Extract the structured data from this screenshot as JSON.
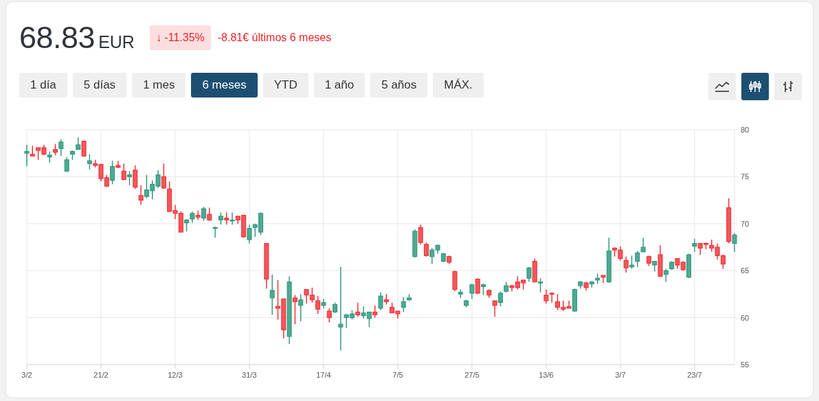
{
  "quote": {
    "price": "68.83",
    "currency": "EUR",
    "change_percent": "↓ -11.35%",
    "change_detail": "-8.81€ últimos 6 meses"
  },
  "ranges": [
    {
      "label": "1 día",
      "selected": false
    },
    {
      "label": "5 días",
      "selected": false
    },
    {
      "label": "1 mes",
      "selected": false
    },
    {
      "label": "6 meses",
      "selected": true
    },
    {
      "label": "YTD",
      "selected": false
    },
    {
      "label": "1 año",
      "selected": false
    },
    {
      "label": "5 años",
      "selected": false
    },
    {
      "label": "MÁX.",
      "selected": false
    }
  ],
  "chart_types": [
    {
      "kind": "line",
      "selected": false
    },
    {
      "kind": "candlestick",
      "selected": true
    },
    {
      "kind": "ohlc",
      "selected": false
    }
  ],
  "chart": {
    "chart_data": {
      "type": "candlestick",
      "grid": true,
      "ylim": [
        55,
        80
      ],
      "yticks": [
        55,
        60,
        65,
        70,
        75,
        80
      ],
      "categories": [
        "3/2",
        null,
        null,
        null,
        null,
        null,
        null,
        null,
        null,
        null,
        null,
        null,
        null,
        "21/2",
        null,
        null,
        null,
        null,
        null,
        null,
        null,
        null,
        null,
        null,
        null,
        null,
        "12/3",
        null,
        null,
        null,
        null,
        null,
        null,
        null,
        null,
        null,
        null,
        null,
        null,
        "31/3",
        null,
        null,
        null,
        null,
        null,
        null,
        null,
        null,
        null,
        null,
        null,
        null,
        "17/4",
        null,
        null,
        null,
        null,
        null,
        null,
        null,
        null,
        null,
        null,
        null,
        null,
        "7/5",
        null,
        null,
        null,
        null,
        null,
        null,
        null,
        null,
        null,
        null,
        null,
        null,
        "27/5",
        null,
        null,
        null,
        null,
        null,
        null,
        null,
        null,
        null,
        null,
        null,
        null,
        "13/6",
        null,
        null,
        null,
        null,
        null,
        null,
        null,
        null,
        null,
        null,
        null,
        null,
        "3/7",
        null,
        null,
        null,
        null,
        null,
        null,
        null,
        null,
        null,
        null,
        null,
        null,
        "23/7",
        null,
        null,
        null,
        null,
        null,
        null,
        null
      ],
      "ohlc": [
        [
          77.5,
          78.4,
          76.1,
          77.7
        ],
        [
          77.4,
          78.3,
          77.2,
          77.2
        ],
        [
          78.1,
          78.1,
          76.8,
          77.8
        ],
        [
          78.1,
          78.4,
          77.3,
          77.4
        ],
        [
          77.1,
          77.7,
          76.5,
          77.3
        ],
        [
          77.9,
          78.5,
          77.3,
          77.6
        ],
        [
          78.0,
          79.0,
          77.2,
          78.7
        ],
        [
          75.6,
          77.1,
          75.5,
          76.8
        ],
        [
          77.4,
          77.8,
          76.8,
          77.7
        ],
        [
          77.9,
          79.2,
          77.9,
          78.4
        ],
        [
          78.8,
          78.8,
          77.2,
          77.2
        ],
        [
          76.4,
          77.4,
          75.8,
          76.7
        ],
        [
          76.4,
          76.8,
          76.0,
          76.2
        ],
        [
          76.3,
          76.4,
          74.5,
          74.8
        ],
        [
          74.9,
          75.2,
          73.9,
          74.0
        ],
        [
          74.6,
          76.7,
          74.2,
          76.1
        ],
        [
          76.2,
          76.7,
          75.9,
          76.0
        ],
        [
          75.6,
          76.4,
          74.6,
          74.7
        ],
        [
          75.0,
          75.6,
          74.1,
          75.2
        ],
        [
          75.7,
          76.2,
          73.7,
          73.9
        ],
        [
          73.0,
          74.1,
          72.0,
          72.5
        ],
        [
          72.9,
          75.2,
          72.7,
          73.6
        ],
        [
          73.5,
          74.6,
          72.6,
          74.2
        ],
        [
          74.0,
          75.7,
          73.8,
          75.2
        ],
        [
          75.0,
          76.4,
          73.7,
          73.8
        ],
        [
          73.7,
          74.5,
          71.3,
          71.3
        ],
        [
          71.4,
          72.0,
          70.5,
          71.1
        ],
        [
          71.1,
          71.3,
          69.1,
          69.1
        ],
        [
          70.1,
          70.5,
          69.2,
          70.4
        ],
        [
          70.5,
          71.3,
          70.1,
          71.1
        ],
        [
          70.9,
          71.4,
          70.4,
          70.7
        ],
        [
          70.6,
          71.8,
          70.3,
          71.6
        ],
        [
          71.0,
          71.7,
          70.3,
          70.4
        ],
        [
          69.5,
          69.7,
          68.5,
          69.6
        ],
        [
          70.4,
          71.2,
          69.9,
          70.8
        ],
        [
          70.6,
          71.2,
          69.9,
          70.4
        ],
        [
          70.3,
          71.2,
          69.9,
          70.4
        ],
        [
          70.8,
          70.8,
          70.0,
          70.4
        ],
        [
          70.9,
          70.9,
          68.5,
          68.6
        ],
        [
          68.3,
          69.9,
          67.9,
          69.5
        ],
        [
          69.6,
          70.0,
          68.6,
          69.9
        ],
        [
          69.1,
          71.2,
          68.8,
          71.1
        ],
        [
          67.9,
          67.9,
          63.1,
          64.1
        ],
        [
          62.1,
          64.6,
          60.3,
          62.9
        ],
        [
          61.2,
          64.0,
          59.8,
          61.0
        ],
        [
          62.0,
          62.0,
          57.8,
          58.7
        ],
        [
          58.0,
          64.4,
          57.2,
          63.8
        ],
        [
          62.1,
          62.4,
          59.3,
          61.7
        ],
        [
          61.3,
          62.5,
          59.6,
          61.9
        ],
        [
          63.0,
          63.0,
          61.5,
          62.4
        ],
        [
          62.4,
          63.2,
          61.6,
          61.9
        ],
        [
          61.8,
          62.3,
          60.4,
          60.9
        ],
        [
          61.3,
          62.0,
          61.0,
          61.6
        ],
        [
          60.7,
          61.0,
          59.5,
          60.0
        ],
        [
          60.6,
          61.6,
          60.5,
          61.4
        ],
        [
          59.0,
          65.4,
          56.5,
          59.3
        ],
        [
          60.0,
          60.4,
          58.9,
          60.3
        ],
        [
          60.0,
          60.8,
          59.8,
          60.4
        ],
        [
          60.6,
          61.6,
          60.1,
          60.3
        ],
        [
          60.2,
          61.2,
          59.9,
          60.5
        ],
        [
          59.9,
          60.6,
          59.0,
          60.6
        ],
        [
          60.6,
          61.3,
          60.0,
          60.3
        ],
        [
          61.0,
          62.7,
          60.8,
          62.3
        ],
        [
          61.9,
          62.5,
          61.4,
          61.7
        ],
        [
          61.1,
          61.6,
          60.5,
          60.5
        ],
        [
          60.7,
          60.7,
          59.9,
          60.4
        ],
        [
          61.1,
          62.2,
          60.6,
          61.7
        ],
        [
          61.9,
          62.5,
          61.8,
          62.1
        ],
        [
          66.5,
          69.4,
          66.4,
          69.2
        ],
        [
          69.6,
          69.9,
          67.8,
          68.0
        ],
        [
          67.8,
          68.0,
          66.5,
          66.6
        ],
        [
          66.5,
          67.4,
          65.7,
          67.2
        ],
        [
          67.2,
          67.8,
          66.8,
          67.7
        ],
        [
          66.0,
          66.9,
          65.9,
          66.8
        ],
        [
          66.5,
          66.6,
          65.7,
          65.9
        ],
        [
          64.9,
          65.0,
          62.8,
          63.0
        ],
        [
          62.5,
          63.0,
          62.1,
          62.7
        ],
        [
          61.3,
          61.9,
          61.1,
          61.8
        ],
        [
          62.6,
          63.6,
          62.0,
          63.5
        ],
        [
          64.1,
          64.2,
          62.5,
          62.6
        ],
        [
          63.3,
          63.6,
          62.4,
          63.5
        ],
        [
          62.9,
          63.0,
          62.1,
          62.4
        ],
        [
          61.8,
          61.8,
          60.1,
          61.3
        ],
        [
          61.6,
          62.8,
          61.2,
          62.6
        ],
        [
          62.8,
          63.8,
          62.7,
          63.4
        ],
        [
          63.4,
          63.5,
          62.8,
          63.2
        ],
        [
          63.8,
          64.4,
          63.0,
          63.2
        ],
        [
          64.0,
          64.0,
          63.0,
          63.7
        ],
        [
          64.2,
          65.4,
          63.8,
          65.3
        ],
        [
          66.0,
          66.3,
          63.8,
          63.8
        ],
        [
          63.7,
          64.2,
          62.7,
          63.8
        ],
        [
          62.4,
          63.0,
          61.5,
          61.8
        ],
        [
          62.6,
          62.7,
          61.6,
          62.5
        ],
        [
          61.7,
          62.5,
          60.8,
          61.1
        ],
        [
          61.1,
          61.8,
          60.7,
          60.9
        ],
        [
          61.2,
          61.8,
          61.0,
          61.0
        ],
        [
          60.7,
          63.1,
          60.6,
          63.0
        ],
        [
          63.4,
          63.9,
          63.1,
          63.8
        ],
        [
          63.7,
          63.8,
          62.9,
          63.2
        ],
        [
          63.6,
          63.9,
          63.2,
          63.8
        ],
        [
          64.0,
          64.7,
          63.6,
          64.2
        ],
        [
          64.5,
          64.5,
          63.7,
          64.3
        ],
        [
          63.8,
          68.5,
          63.7,
          67.1
        ],
        [
          67.4,
          67.5,
          66.5,
          67.2
        ],
        [
          67.2,
          67.6,
          66.1,
          66.3
        ],
        [
          66.1,
          66.5,
          64.8,
          65.3
        ],
        [
          65.4,
          66.6,
          65.2,
          65.6
        ],
        [
          66.0,
          67.1,
          65.4,
          66.9
        ],
        [
          67.0,
          68.5,
          67.0,
          67.5
        ],
        [
          66.5,
          66.6,
          65.5,
          65.8
        ],
        [
          65.6,
          66.0,
          64.9,
          66.0
        ],
        [
          66.7,
          67.7,
          64.4,
          64.4
        ],
        [
          64.6,
          65.2,
          63.8,
          65.0
        ],
        [
          65.2,
          66.0,
          65.1,
          65.9
        ],
        [
          66.3,
          66.3,
          65.2,
          65.6
        ],
        [
          65.9,
          66.0,
          65.0,
          65.1
        ],
        [
          64.3,
          66.8,
          64.2,
          66.7
        ],
        [
          67.6,
          68.4,
          67.0,
          67.9
        ],
        [
          67.9,
          67.9,
          66.7,
          67.4
        ],
        [
          67.9,
          68.0,
          67.3,
          67.8
        ],
        [
          67.7,
          68.3,
          67.0,
          67.4
        ],
        [
          67.5,
          67.9,
          66.2,
          66.6
        ],
        [
          66.6,
          66.7,
          65.2,
          65.7
        ],
        [
          71.7,
          72.7,
          67.9,
          68.1
        ],
        [
          67.9,
          69.0,
          67.0,
          68.8
        ]
      ]
    }
  }
}
